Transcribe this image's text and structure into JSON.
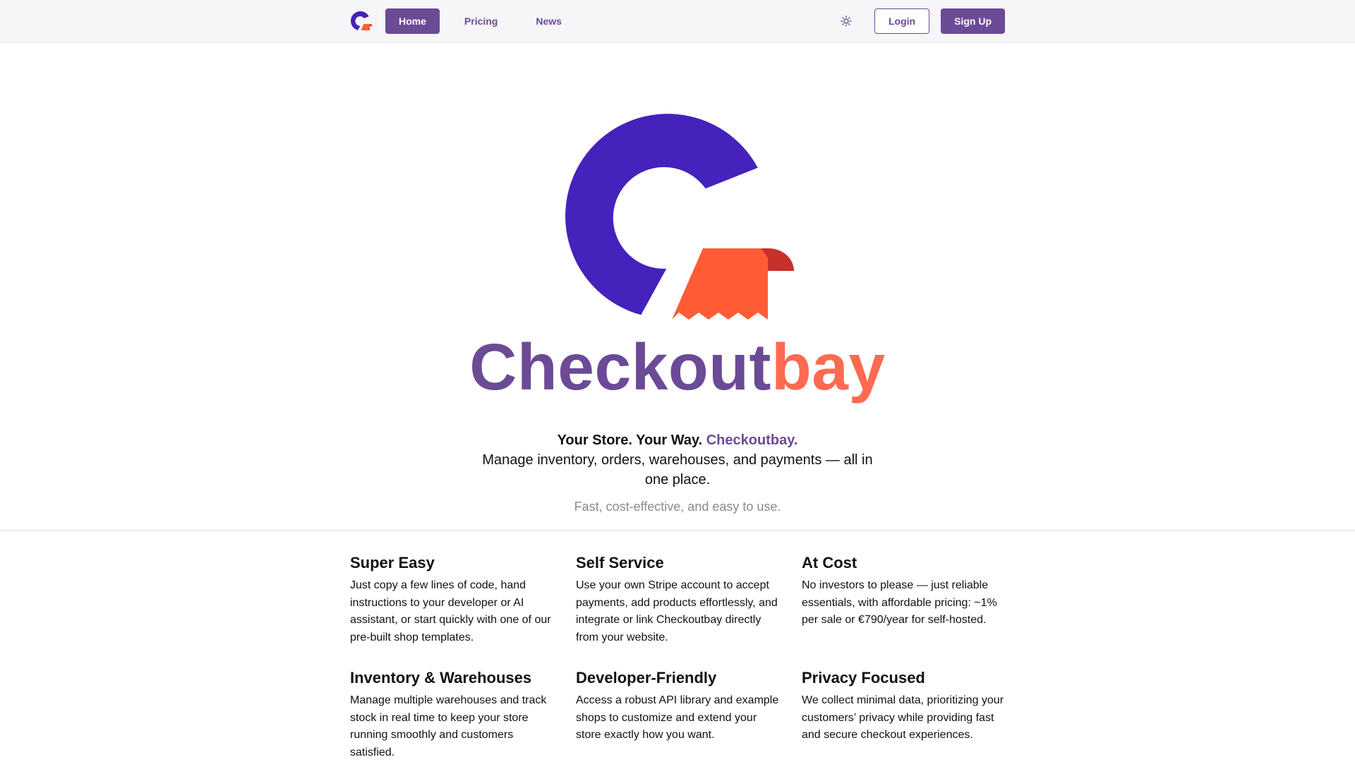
{
  "colors": {
    "brand_purple": "#6b4a96",
    "brand_orange": "#ff6a52",
    "logo_indigo": "#4422bb",
    "logo_red": "#c8302a"
  },
  "nav": {
    "logo_icon": "checkoutbay-logo",
    "links": [
      {
        "label": "Home",
        "active": true
      },
      {
        "label": "Pricing",
        "active": false
      },
      {
        "label": "News",
        "active": false
      }
    ],
    "theme_icon": "sun-icon",
    "login_label": "Login",
    "signup_label": "Sign Up"
  },
  "hero": {
    "logo_icon": "checkoutbay-logo",
    "wordmark_part1": "Checkout",
    "wordmark_part2": "bay",
    "tagline_strong": "Your Store. Your Way.",
    "tagline_brand": "Checkoutbay.",
    "tagline_desc": "Manage inventory, orders, warehouses, and payments — all in one place.",
    "subtitle": "Fast, cost-effective, and easy to use."
  },
  "features": [
    {
      "title": "Super Easy",
      "text": "Just copy a few lines of code, hand instructions to your developer or AI assistant, or start quickly with one of our pre-built shop templates."
    },
    {
      "title": "Self Service",
      "text": "Use your own Stripe account to accept payments, add products effortlessly, and integrate or link Checkoutbay directly from your website."
    },
    {
      "title": "At Cost",
      "text": "No investors to please — just reliable essentials, with affordable pricing: ~1% per sale or €790/year for self-hosted."
    },
    {
      "title": "Inventory & Warehouses",
      "text": "Manage multiple warehouses and track stock in real time to keep your store running smoothly and customers satisfied."
    },
    {
      "title": "Developer-Friendly",
      "text": "Access a robust API library and example shops to customize and extend your store exactly how you want."
    },
    {
      "title": "Privacy Focused",
      "text": "We collect minimal data, prioritizing your customers’ privacy while providing fast and secure checkout experiences."
    }
  ]
}
